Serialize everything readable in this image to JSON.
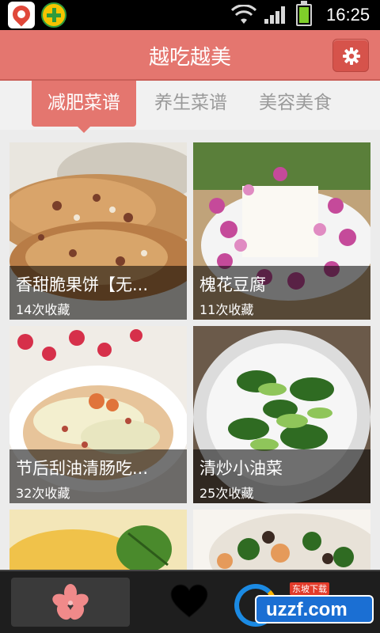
{
  "status_bar": {
    "time": "16:25",
    "icons": [
      "app-pin-icon",
      "app-plus-icon",
      "wifi-icon",
      "signal-icon",
      "battery-icon"
    ]
  },
  "header": {
    "title": "越吃越美",
    "settings_icon": "gear-icon",
    "accent_color": "#e4766f"
  },
  "tabs": [
    {
      "label": "减肥菜谱",
      "active": true
    },
    {
      "label": "养生菜谱",
      "active": false
    },
    {
      "label": "美容美食",
      "active": false
    }
  ],
  "recipes": [
    {
      "title": "香甜脆果饼【无...",
      "favorites": "14次收藏"
    },
    {
      "title": "槐花豆腐",
      "favorites": "11次收藏"
    },
    {
      "title": "节后刮油清肠吃...",
      "favorites": "32次收藏"
    },
    {
      "title": "清炒小油菜",
      "favorites": "25次收藏"
    },
    {
      "title": "",
      "favorites": ""
    },
    {
      "title": "",
      "favorites": ""
    }
  ],
  "bottom_bar": {
    "items": [
      "flower-home-icon",
      "heart-icon",
      "menu-icon"
    ]
  },
  "watermark": {
    "brand": "uzzf.com",
    "tag": "东坡下载"
  }
}
